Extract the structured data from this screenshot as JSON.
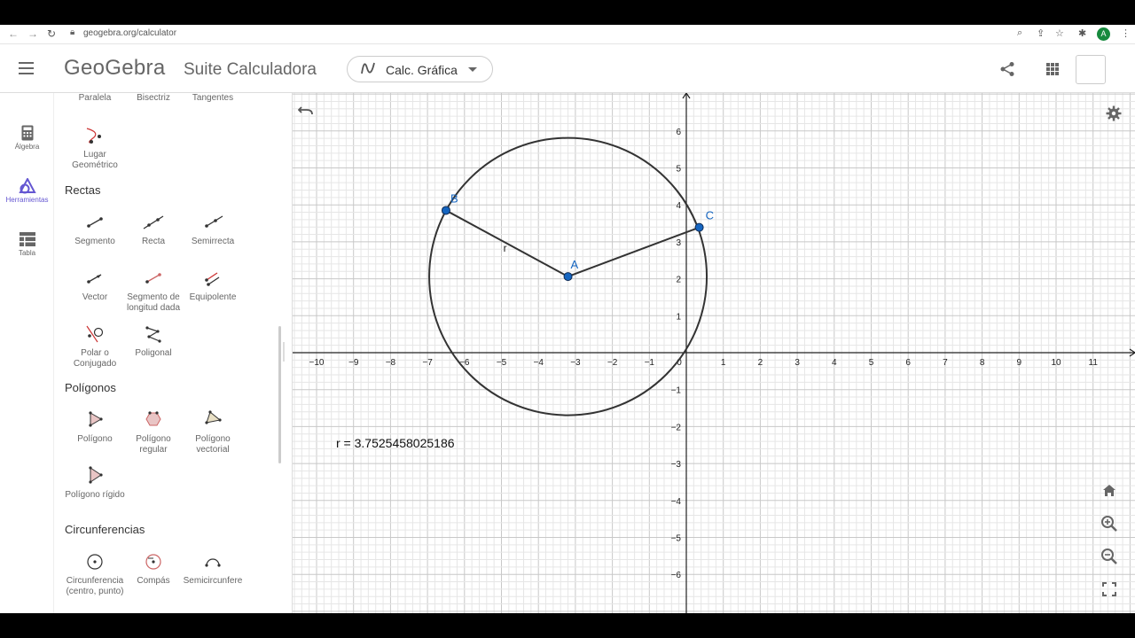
{
  "browser": {
    "url": "geogebra.org/calculator",
    "profile_initial": "A"
  },
  "header": {
    "logo": "GeoGebra",
    "title": "Suite Calculadora",
    "app_selector": "Calc. Gráfica"
  },
  "rail": {
    "items": [
      {
        "label": "Álgebra",
        "icon": "calculator-icon"
      },
      {
        "label": "Herramientas",
        "icon": "tools-icon",
        "active": true
      },
      {
        "label": "Tabla",
        "icon": "table-icon"
      }
    ]
  },
  "tools": {
    "top_row": [
      "Paralela",
      "Bisectriz",
      "Tangentes"
    ],
    "lugar": "Lugar Geométrico",
    "sections": {
      "rectas": "Rectas",
      "poligonos": "Polígonos",
      "circunferencias": "Circunferencias"
    },
    "rectas": [
      "Segmento",
      "Recta",
      "Semirrecta",
      "Vector",
      "Segmento de longitud dada",
      "Equipolente",
      "Polar o Conjugado",
      "Poligonal"
    ],
    "poligonos": [
      "Polígono",
      "Polígono regular",
      "Polígono vectorial",
      "Polígono rígido"
    ],
    "circunferencias": [
      "Circunferencia (centro, punto)",
      "Compás",
      "Semicircunfere"
    ]
  },
  "graphics": {
    "x_ticks": [
      "−10",
      "−9",
      "−8",
      "−7",
      "−6",
      "−5",
      "−4",
      "−3",
      "−2",
      "−1",
      "0",
      "1",
      "2",
      "3",
      "4",
      "5",
      "6",
      "7",
      "8",
      "9",
      "10",
      "11"
    ],
    "y_ticks_pos": [
      "6",
      "5",
      "4",
      "3",
      "2",
      "1"
    ],
    "y_ticks_neg": [
      "−1",
      "−2",
      "−3",
      "−4",
      "−5",
      "−6"
    ],
    "points": {
      "A": {
        "label": "A",
        "x": -3.2,
        "y": 2.06
      },
      "B": {
        "label": "B",
        "x": -6.5,
        "y": 3.85
      },
      "C": {
        "label": "C",
        "x": 0.35,
        "y": 3.39
      }
    },
    "radius_label": "r",
    "radius_value_text": "r  =  3.7525458025186",
    "circle": {
      "center_x": -3.2,
      "center_y": 2.06,
      "r": 3.7525458025186
    },
    "colors": {
      "point": "#1565c0",
      "point_label": "#1565c0",
      "stroke": "#333333",
      "grid_minor": "#e6e6e6",
      "grid_major": "#c8c8c8"
    }
  }
}
